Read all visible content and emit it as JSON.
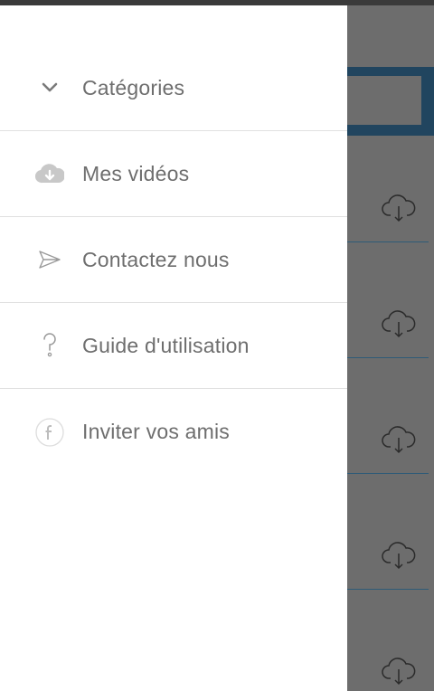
{
  "drawer": {
    "items": [
      {
        "label": "Catégories",
        "icon": "chevron-down-icon"
      },
      {
        "label": "Mes vidéos",
        "icon": "cloud-download-icon"
      },
      {
        "label": "Contactez nous",
        "icon": "send-icon"
      },
      {
        "label": "Guide d'utilisation",
        "icon": "question-icon"
      },
      {
        "label": "Inviter vos amis",
        "icon": "facebook-icon"
      }
    ]
  },
  "background": {
    "list_items": [
      {
        "icon": "cloud-download-icon"
      },
      {
        "icon": "cloud-download-icon"
      },
      {
        "icon": "cloud-download-icon"
      },
      {
        "icon": "cloud-download-icon"
      },
      {
        "icon": "cloud-download-icon"
      }
    ]
  },
  "colors": {
    "accent": "#21455f",
    "overlay": "#6d6d6d",
    "text": "#6e6e6e"
  }
}
